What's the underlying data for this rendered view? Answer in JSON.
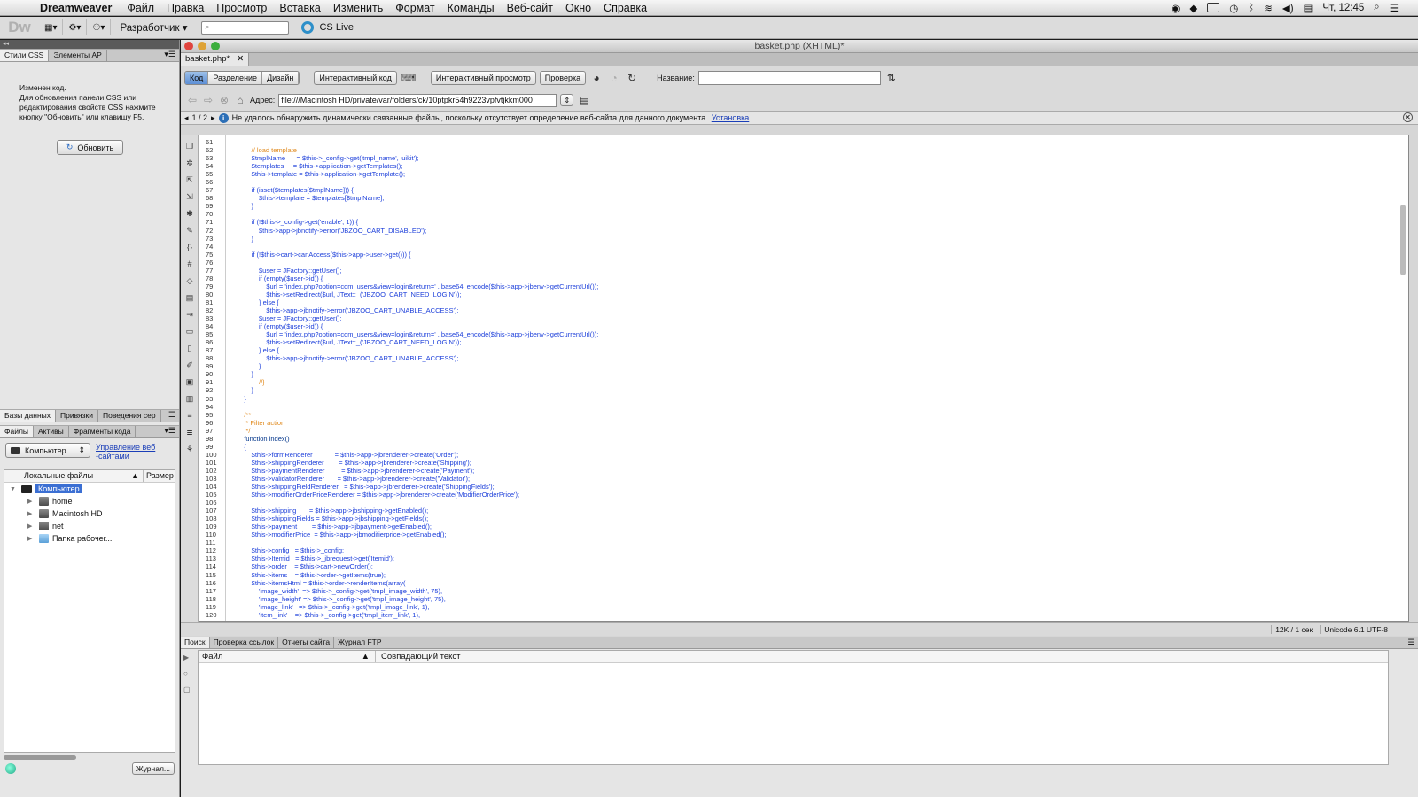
{
  "menubar": {
    "app_name": "Dreamweaver",
    "menus": [
      "Файл",
      "Правка",
      "Просмотр",
      "Вставка",
      "Изменить",
      "Формат",
      "Команды",
      "Веб-сайт",
      "Окно",
      "Справка"
    ],
    "clock": "Чт, 12:45"
  },
  "appbar": {
    "logo": "Dw",
    "workspace": "Разработчик",
    "search_placeholder": "",
    "cslive": "CS Live"
  },
  "left_panel": {
    "top_tabs": [
      "Стили CSS",
      "Элементы AP"
    ],
    "css_message_lines": [
      "Изменен код.",
      "Для обновления панели CSS или",
      "редактирования свойств CSS нажмите",
      "кнопку \"Обновить\" или клавишу F5."
    ],
    "refresh_button": "Обновить",
    "mid_tabs": [
      "Базы данных",
      "Привязки",
      "Поведения сер"
    ],
    "files_tabs": [
      "Файлы",
      "Активы",
      "Фрагменты кода"
    ],
    "site_dropdown": "Компьютер",
    "manage_sites_link_lines": [
      "Управление веб",
      "-сайтами"
    ],
    "file_columns": [
      "Локальные файлы",
      "Размер"
    ],
    "tree_root": "Компьютер",
    "tree_items": [
      "home",
      "Macintosh HD",
      "net",
      "Папка рабочег..."
    ],
    "log_button": "Журнал..."
  },
  "document": {
    "window_title": "basket.php (XHTML)*",
    "tab_name": "basket.php*",
    "view_buttons": [
      "Код",
      "Разделение",
      "Дизайн"
    ],
    "live_code": "Интерактивный код",
    "live_view": "Интерактивный просмотр",
    "check": "Проверка",
    "title_label": "Название:",
    "title_value": "",
    "address_label": "Адрес:",
    "address_value": "file:///Macintosh HD/private/var/folders/ck/10ptpkr54h9223vpfvtjkkm000",
    "info_counter": "1 / 2",
    "info_message": "Не удалось обнаружить динамически связанные файлы, поскольку отсутствует определение веб-сайта для данного документа.",
    "info_link": "Установка"
  },
  "code": {
    "lines": [
      {
        "n": "61",
        "t": ""
      },
      {
        "n": "62",
        "t": "        // load template",
        "c": "cm"
      },
      {
        "n": "63",
        "t": "        $tmplName      = $this->_config->get('tmpl_name', 'uikit');"
      },
      {
        "n": "64",
        "t": "        $templates     = $this->application->getTemplates();"
      },
      {
        "n": "65",
        "t": "        $this->template = $this->application->getTemplate();"
      },
      {
        "n": "66",
        "t": ""
      },
      {
        "n": "67",
        "t": "        if (isset($templates[$tmplName])) {"
      },
      {
        "n": "68",
        "t": "            $this->template = $templates[$tmplName];"
      },
      {
        "n": "69",
        "t": "        }"
      },
      {
        "n": "70",
        "t": ""
      },
      {
        "n": "71",
        "t": "        if (!$this->_config->get('enable', 1)) {"
      },
      {
        "n": "72",
        "t": "            $this->app->jbnotify->error('JBZOO_CART_DISABLED');"
      },
      {
        "n": "73",
        "t": "        }"
      },
      {
        "n": "74",
        "t": ""
      },
      {
        "n": "75",
        "t": "        if (!$this->cart->canAccess($this->app->user->get())) {"
      },
      {
        "n": "76",
        "t": ""
      },
      {
        "n": "77",
        "t": "            $user = JFactory::getUser();"
      },
      {
        "n": "78",
        "t": "            if (empty($user->id)) {"
      },
      {
        "n": "79",
        "t": "                $url = 'index.php?option=com_users&view=login&return=' . base64_encode($this->app->jbenv->getCurrentUrl());"
      },
      {
        "n": "80",
        "t": "                $this->setRedirect($url, JText::_('JBZOO_CART_NEED_LOGIN'));"
      },
      {
        "n": "81",
        "t": "            } else {"
      },
      {
        "n": "82",
        "t": "                $this->app->jbnotify->error('JBZOO_CART_UNABLE_ACCESS');"
      },
      {
        "n": "83",
        "t": "            $user = JFactory::getUser();"
      },
      {
        "n": "84",
        "t": "            if (empty($user->id)) {"
      },
      {
        "n": "85",
        "t": "                $url = 'index.php?option=com_users&view=login&return=' . base64_encode($this->app->jbenv->getCurrentUrl());"
      },
      {
        "n": "86",
        "t": "                $this->setRedirect($url, JText::_('JBZOO_CART_NEED_LOGIN'));"
      },
      {
        "n": "87",
        "t": "            } else {"
      },
      {
        "n": "88",
        "t": "                $this->app->jbnotify->error('JBZOO_CART_UNABLE_ACCESS');"
      },
      {
        "n": "89",
        "t": "            }"
      },
      {
        "n": "90",
        "t": "        }"
      },
      {
        "n": "91",
        "t": "            //}",
        "c": "cm"
      },
      {
        "n": "92",
        "t": "        }"
      },
      {
        "n": "93",
        "t": "    }"
      },
      {
        "n": "94",
        "t": ""
      },
      {
        "n": "95",
        "t": "    /**",
        "c": "cm"
      },
      {
        "n": "96",
        "t": "     * Filter action",
        "c": "cm"
      },
      {
        "n": "97",
        "t": "     */",
        "c": "cm"
      },
      {
        "n": "98",
        "t": "    function index()",
        "c": "kw"
      },
      {
        "n": "99",
        "t": "    {"
      },
      {
        "n": "100",
        "t": "        $this->formRenderer            = $this->app->jbrenderer->create('Order');"
      },
      {
        "n": "101",
        "t": "        $this->shippingRenderer        = $this->app->jbrenderer->create('Shipping');"
      },
      {
        "n": "102",
        "t": "        $this->paymentRenderer         = $this->app->jbrenderer->create('Payment');"
      },
      {
        "n": "103",
        "t": "        $this->validatorRenderer       = $this->app->jbrenderer->create('Validator');"
      },
      {
        "n": "104",
        "t": "        $this->shippingFieldRenderer   = $this->app->jbrenderer->create('ShippingFields');"
      },
      {
        "n": "105",
        "t": "        $this->modifierOrderPriceRenderer = $this->app->jbrenderer->create('ModifierOrderPrice');"
      },
      {
        "n": "106",
        "t": ""
      },
      {
        "n": "107",
        "t": "        $this->shipping       = $this->app->jbshipping->getEnabled();"
      },
      {
        "n": "108",
        "t": "        $this->shippingFields = $this->app->jbshipping->getFields();"
      },
      {
        "n": "109",
        "t": "        $this->payment        = $this->app->jbpayment->getEnabled();"
      },
      {
        "n": "110",
        "t": "        $this->modifierPrice  = $this->app->jbmodifierprice->getEnabled();"
      },
      {
        "n": "111",
        "t": ""
      },
      {
        "n": "112",
        "t": "        $this->config   = $this->_config;"
      },
      {
        "n": "113",
        "t": "        $this->Itemid   = $this->_jbrequest->get('Itemid');"
      },
      {
        "n": "114",
        "t": "        $this->order    = $this->cart->newOrder();"
      },
      {
        "n": "115",
        "t": "        $this->items    = $this->order->getItems(true);"
      },
      {
        "n": "116",
        "t": "        $this->itemsHtml = $this->order->renderItems(array("
      },
      {
        "n": "117",
        "t": "            'image_width'  => $this->_config->get('tmpl_image_width', 75),"
      },
      {
        "n": "118",
        "t": "            'image_height' => $this->_config->get('tmpl_image_height', 75),"
      },
      {
        "n": "119",
        "t": "            'image_link'   => $this->_config->get('tmpl_image_link', 1),"
      },
      {
        "n": "120",
        "t": "            'item_link'    => $this->_config->get('tmpl_item_link', 1),"
      }
    ]
  },
  "status": {
    "size": "12K / 1 сек",
    "encoding": "Unicode 6.1 UTF-8"
  },
  "results": {
    "tabs": [
      "Поиск",
      "Проверка ссылок",
      "Отчеты сайта",
      "Журнал FTP"
    ],
    "col_file": "Файл",
    "col_match": "Совпадающий текст"
  }
}
